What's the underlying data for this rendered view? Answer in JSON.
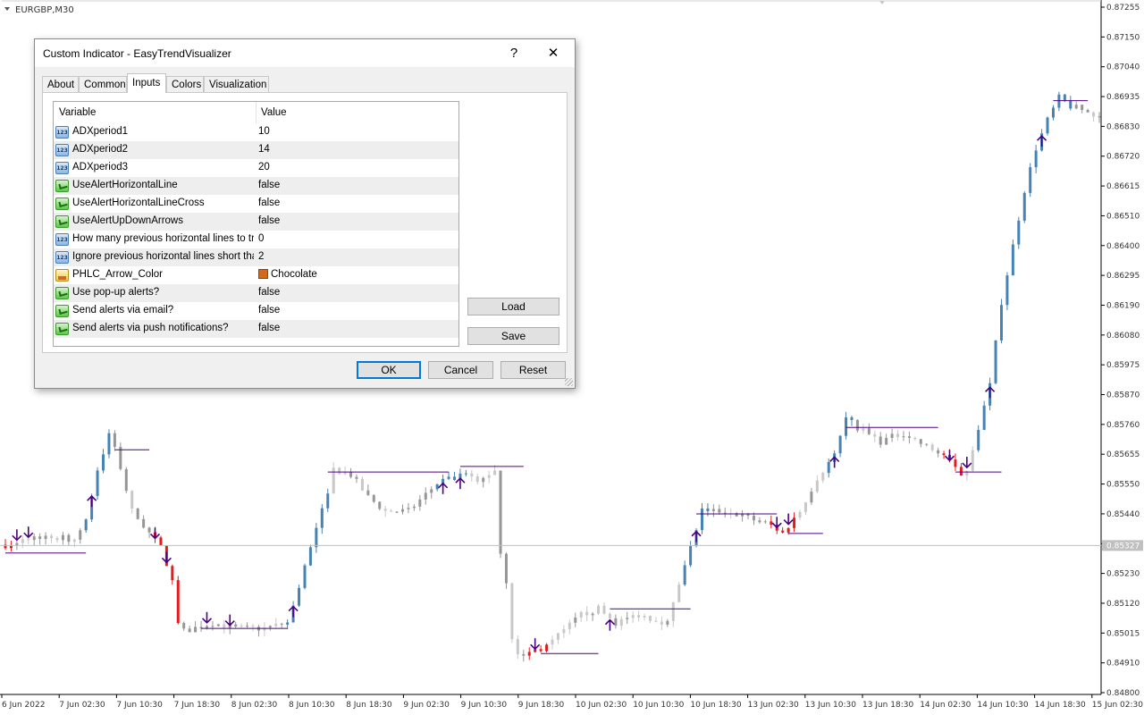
{
  "window": {
    "symbol_label": "EURGBP,M30"
  },
  "colors": {
    "bull": "#4682b4",
    "bear": "#e41a1c",
    "neutral": "#969696",
    "light": "#c8c8c8",
    "arrow": "#4b0082",
    "hline": "#4b0082",
    "price_tag_bg": "#c0c0c0"
  },
  "chart_data": {
    "type": "candlestick",
    "symbol": "EURGBP",
    "timeframe": "M30",
    "y_ticks": [
      "0.87255",
      "0.87150",
      "0.87040",
      "0.86935",
      "0.86830",
      "0.86720",
      "0.86615",
      "0.86510",
      "0.86400",
      "0.86295",
      "0.86190",
      "0.86080",
      "0.85975",
      "0.85870",
      "0.85760",
      "0.85655",
      "0.85550",
      "0.85440",
      "0.85335",
      "0.85230",
      "0.85120",
      "0.85015",
      "0.84910",
      "0.84800"
    ],
    "ylim": [
      0.848,
      0.87255
    ],
    "current_price": "0.85327",
    "x_ticks": [
      "6 Jun 2022",
      "7 Jun 02:30",
      "7 Jun 10:30",
      "7 Jun 18:30",
      "8 Jun 02:30",
      "8 Jun 10:30",
      "8 Jun 18:30",
      "9 Jun 02:30",
      "9 Jun 10:30",
      "9 Jun 18:30",
      "10 Jun 02:30",
      "10 Jun 10:30",
      "10 Jun 18:30",
      "13 Jun 02:30",
      "13 Jun 10:30",
      "13 Jun 18:30",
      "14 Jun 02:30",
      "14 Jun 10:30",
      "14 Jun 18:30",
      "15 Jun 02:30"
    ],
    "close_path": [
      [
        0,
        0.8533
      ],
      [
        6,
        0.8536
      ],
      [
        12,
        0.8535
      ],
      [
        14,
        0.8542
      ],
      [
        16,
        0.856
      ],
      [
        18,
        0.8572
      ],
      [
        19,
        0.8568
      ],
      [
        22,
        0.8545
      ],
      [
        27,
        0.8532
      ],
      [
        29,
        0.852
      ],
      [
        30,
        0.8505
      ],
      [
        31,
        0.8502
      ],
      [
        36,
        0.8505
      ],
      [
        40,
        0.8503
      ],
      [
        45,
        0.8503
      ],
      [
        49,
        0.8505
      ],
      [
        51,
        0.8518
      ],
      [
        52,
        0.8525
      ],
      [
        55,
        0.8545
      ],
      [
        57,
        0.856
      ],
      [
        60,
        0.8558
      ],
      [
        63,
        0.855
      ],
      [
        66,
        0.8545
      ],
      [
        70,
        0.8545
      ],
      [
        75,
        0.8555
      ],
      [
        80,
        0.8558
      ],
      [
        82,
        0.8555
      ],
      [
        85,
        0.856
      ],
      [
        86,
        0.853
      ],
      [
        87,
        0.852
      ],
      [
        88,
        0.85
      ],
      [
        89,
        0.8493
      ],
      [
        92,
        0.8495
      ],
      [
        94,
        0.8497
      ],
      [
        97,
        0.8502
      ],
      [
        100,
        0.8508
      ],
      [
        103,
        0.851
      ],
      [
        106,
        0.8505
      ],
      [
        110,
        0.8508
      ],
      [
        115,
        0.8505
      ],
      [
        118,
        0.8525
      ],
      [
        121,
        0.8545
      ],
      [
        125,
        0.8545
      ],
      [
        130,
        0.8542
      ],
      [
        133,
        0.854
      ],
      [
        135,
        0.8537
      ],
      [
        138,
        0.8545
      ],
      [
        141,
        0.8557
      ],
      [
        144,
        0.8565
      ],
      [
        146,
        0.8578
      ],
      [
        148,
        0.8575
      ],
      [
        152,
        0.857
      ],
      [
        156,
        0.8573
      ],
      [
        160,
        0.8568
      ],
      [
        163,
        0.8565
      ],
      [
        165,
        0.856
      ],
      [
        166,
        0.8558
      ],
      [
        167,
        0.856
      ],
      [
        169,
        0.8575
      ],
      [
        171,
        0.859
      ],
      [
        173,
        0.862
      ],
      [
        175,
        0.864
      ],
      [
        177,
        0.866
      ],
      [
        179,
        0.8675
      ],
      [
        181,
        0.8685
      ],
      [
        183,
        0.8693
      ],
      [
        185,
        0.869
      ],
      [
        188,
        0.8688
      ],
      [
        190,
        0.8685
      ]
    ],
    "arrows": [
      [
        2,
        "down"
      ],
      [
        4,
        "down"
      ],
      [
        15,
        "up"
      ],
      [
        26,
        "down"
      ],
      [
        28,
        "down"
      ],
      [
        35,
        "down"
      ],
      [
        39,
        "down"
      ],
      [
        50,
        "up"
      ],
      [
        76,
        "up"
      ],
      [
        79,
        "up"
      ],
      [
        92,
        "down"
      ],
      [
        105,
        "up"
      ],
      [
        120,
        "up"
      ],
      [
        134,
        "down"
      ],
      [
        136,
        "down"
      ],
      [
        144,
        "up"
      ],
      [
        164,
        "down"
      ],
      [
        167,
        "down"
      ],
      [
        171,
        "up"
      ],
      [
        180,
        "up"
      ]
    ],
    "hlines": [
      [
        0,
        14,
        0.853
      ],
      [
        19,
        25,
        0.8567
      ],
      [
        34,
        49,
        0.8503
      ],
      [
        56,
        77,
        0.8559
      ],
      [
        79,
        90,
        0.8561
      ],
      [
        93,
        103,
        0.8494
      ],
      [
        105,
        119,
        0.851
      ],
      [
        120,
        134,
        0.8544
      ],
      [
        136,
        142,
        0.8537
      ],
      [
        146,
        162,
        0.8575
      ],
      [
        165,
        173,
        0.8559
      ],
      [
        182,
        188,
        0.8692
      ]
    ],
    "red_ranges": [
      [
        0,
        1
      ],
      [
        26,
        30
      ],
      [
        91,
        94
      ],
      [
        133,
        137
      ],
      [
        163,
        166
      ]
    ],
    "blue_ranges": [
      [
        14,
        18
      ],
      [
        49,
        56
      ],
      [
        75,
        80
      ],
      [
        118,
        122
      ],
      [
        143,
        147
      ],
      [
        169,
        185
      ]
    ]
  },
  "dialog": {
    "title": "Custom Indicator - EasyTrendVisualizer",
    "help_glyph": "?",
    "close_glyph": "✕",
    "tabs": [
      "About",
      "Common",
      "Inputs",
      "Colors",
      "Visualization"
    ],
    "active_tab": "Inputs",
    "columns": {
      "variable": "Variable",
      "value": "Value"
    },
    "rows": [
      {
        "icon": "number-icon",
        "variable": "ADXperiod1",
        "value": "10"
      },
      {
        "icon": "number-icon",
        "variable": "ADXperiod2",
        "value": "14"
      },
      {
        "icon": "number-icon",
        "variable": "ADXperiod3",
        "value": "20"
      },
      {
        "icon": "boolean-icon",
        "variable": "UseAlertHorizontalLine",
        "value": "false"
      },
      {
        "icon": "boolean-icon",
        "variable": "UseAlertHorizontalLineCross",
        "value": "false"
      },
      {
        "icon": "boolean-icon",
        "variable": "UseAlertUpDownArrows",
        "value": "false"
      },
      {
        "icon": "number-icon",
        "variable": "How many previous horizontal lines to tra...",
        "value": "0"
      },
      {
        "icon": "number-icon",
        "variable": "Ignore previous horizontal lines short than",
        "value": "2"
      },
      {
        "icon": "color-icon",
        "variable": "PHLC_Arrow_Color",
        "value": "Chocolate",
        "swatch": "#d2691e"
      },
      {
        "icon": "boolean-icon",
        "variable": "Use pop-up alerts?",
        "value": "false"
      },
      {
        "icon": "boolean-icon",
        "variable": "Send alerts via email?",
        "value": "false"
      },
      {
        "icon": "boolean-icon",
        "variable": "Send alerts via push notifications?",
        "value": "false"
      }
    ],
    "buttons": {
      "load": "Load",
      "save": "Save",
      "ok": "OK",
      "cancel": "Cancel",
      "reset": "Reset"
    }
  }
}
